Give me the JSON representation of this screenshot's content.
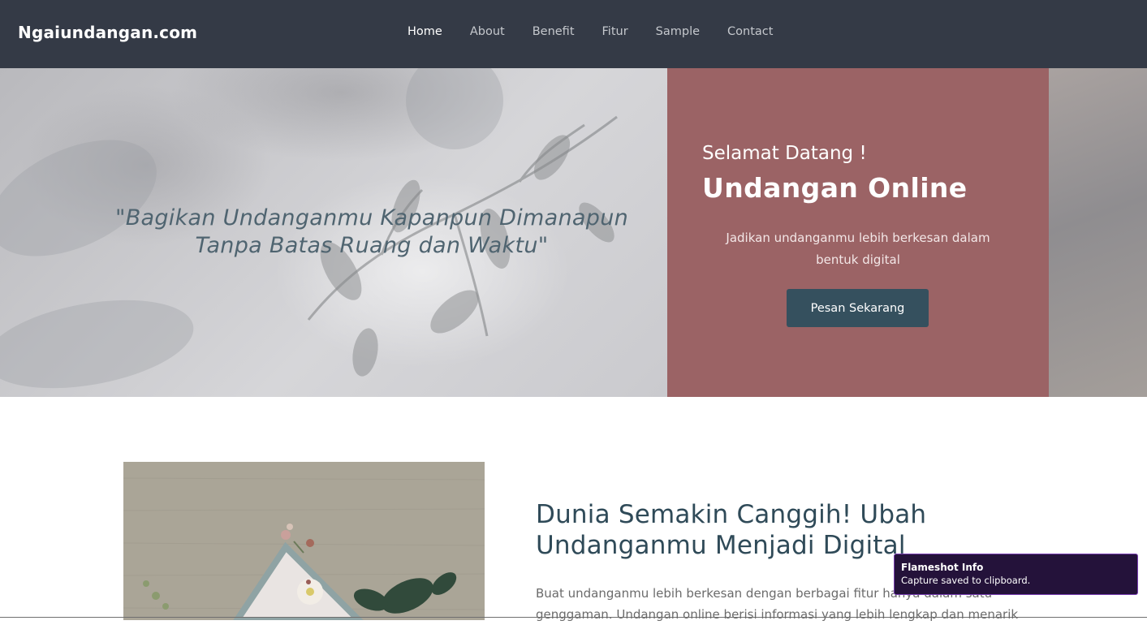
{
  "brand": "Ngaiundangan.com",
  "nav": {
    "items": [
      "Home",
      "About",
      "Benefit",
      "Fitur",
      "Sample",
      "Contact"
    ],
    "active": "Home"
  },
  "hero": {
    "quote_line1": "\"Bagikan Undanganmu Kapanpun Dimanapun",
    "quote_line2": "Tanpa Batas Ruang dan Waktu\"",
    "welcome": "Selamat Datang !",
    "headline": "Undangan Online",
    "subtitle": "Jadikan undanganmu lebih berkesan dalam bentuk digital",
    "cta": "Pesan Sekarang"
  },
  "about": {
    "title": "Dunia Semakin Canggih! Ubah Undanganmu Menjadi Digital",
    "text": "Buat undanganmu lebih berkesan dengan berbagai fitur hanya dalam satu genggaman. Undangan online berisi informasi yang lebih lengkap dan menarik"
  },
  "toast": {
    "title": "Flameshot Info",
    "body": "Capture saved to clipboard."
  },
  "colors": {
    "navbar": "#343a46",
    "panel": "#9b6365",
    "button": "#35505e",
    "heading": "#2f4a58"
  }
}
